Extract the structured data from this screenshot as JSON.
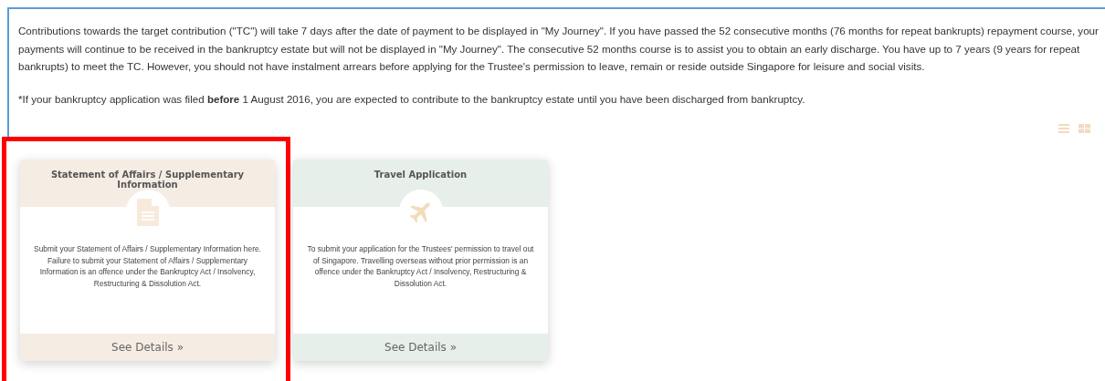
{
  "notice": {
    "paragraphs": [
      "Contributions towards the target contribution (\"TC\") will take 7 days after the date of payment to be displayed in \"My Journey\". If you have passed the 52 consecutive months (76 months for repeat bankrupts) repayment course, your payments will continue to be received in the bankruptcy estate but will not be displayed in \"My Journey\". The consecutive 52 months course is to assist you to obtain an early discharge. You have up to 7 years (9 years for repeat bankrupts) to meet the TC. However, you should not have instalment arrears before applying for the Trustee's permission to leave, remain or reside outside Singapore for leisure and social visits.",
      "*If your bankruptcy application was filed **before** 1 August 2016, you are expected to contribute to the bankruptcy estate until you have been discharged from bankruptcy."
    ]
  },
  "cards": [
    {
      "title": "Statement of Affairs / Supplementary Information",
      "kind": "document",
      "color": "#f5ede4",
      "description": "Submit your Statement of Affairs / Supplementary Information here. Failure to submit your Statement of Affairs / Supplementary Information is an offence under the Bankruptcy Act / Insolvency, Restructuring & Dissolution Act.",
      "link": "See Details »",
      "highlighted": true
    },
    {
      "title": "Travel Application",
      "kind": "plane",
      "color": "#e6efe9",
      "description": "To submit your application for the Trustees' permission to travel out of Singapore. Travelling overseas without prior permission is an offence under the Bankruptcy Act / Insolvency, Restructuring & Dissolution Act.",
      "link": "See Details »",
      "highlighted": false
    }
  ]
}
